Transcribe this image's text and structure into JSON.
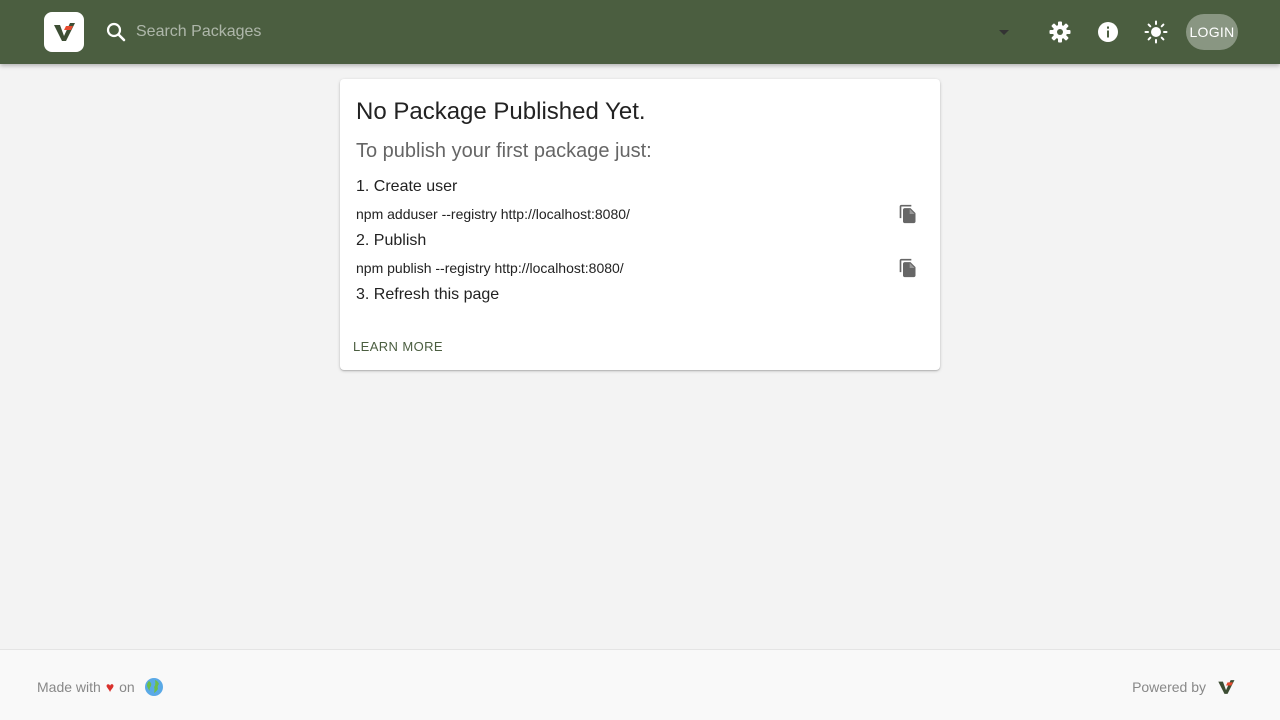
{
  "header": {
    "logo": "verdaccio-logo-icon",
    "search": {
      "placeholder": "Search Packages",
      "value": ""
    },
    "actions": [
      "gear-icon",
      "info-icon",
      "sun-icon"
    ],
    "login_label": "LOGIN",
    "colors": {
      "bar": "#4b5e40"
    }
  },
  "card": {
    "title": "No Package Published Yet.",
    "subtitle": "To publish your first package just:",
    "steps": [
      {
        "label": "1. Create user",
        "command": "npm adduser --registry http://localhost:8080/"
      },
      {
        "label": "2. Publish",
        "command": "npm publish --registry http://localhost:8080/"
      },
      {
        "label": "3. Refresh this page"
      }
    ],
    "learn_more": "LEARN MORE"
  },
  "footer": {
    "made_with": "Made with",
    "heart": "♥",
    "on": "on",
    "powered_by": "Powered by"
  }
}
